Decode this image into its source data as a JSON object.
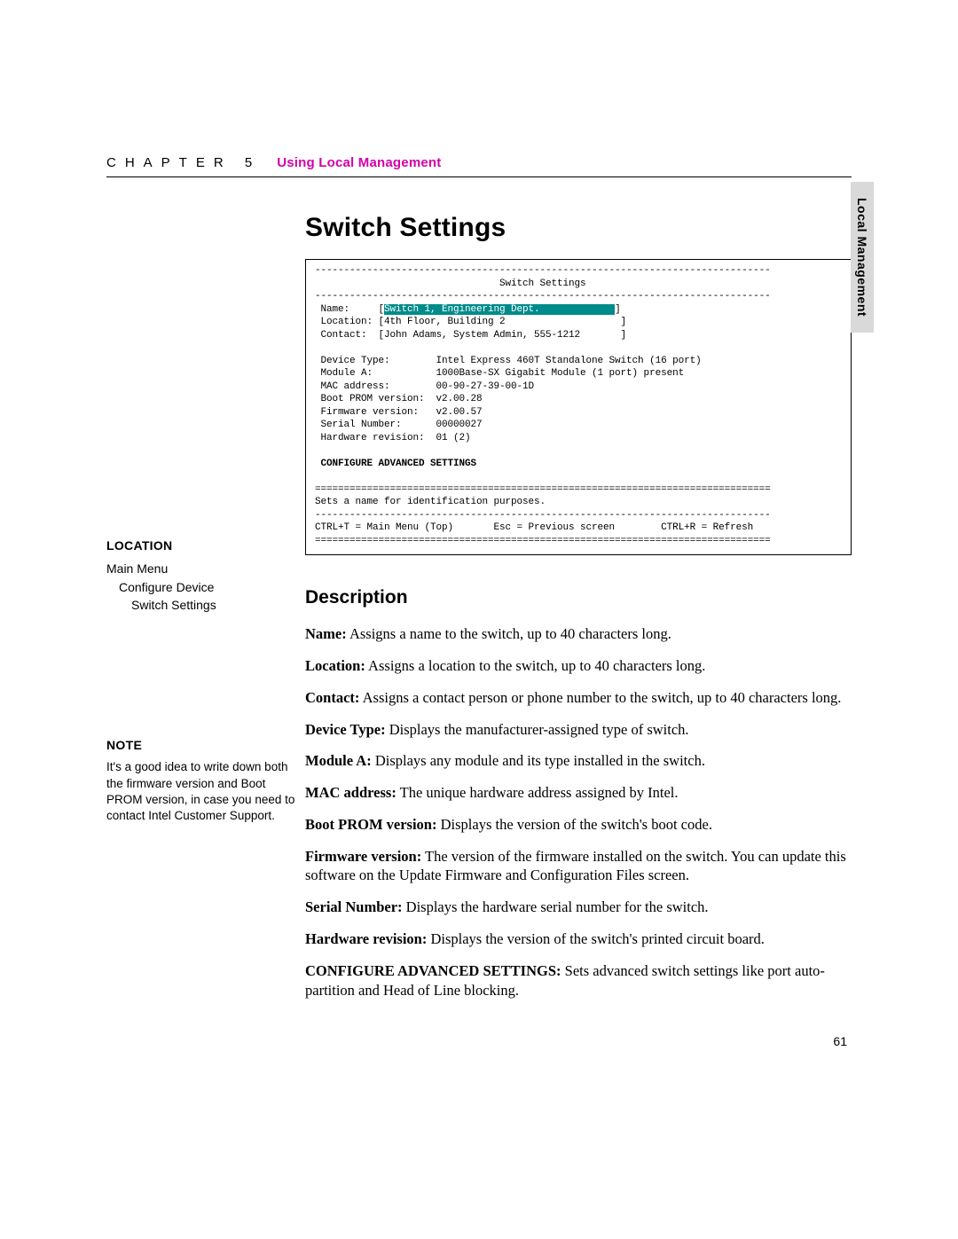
{
  "header": {
    "chapter_label": "CHAPTER 5",
    "chapter_title": "Using Local Management"
  },
  "side_tab": "Local Management",
  "page_number": "61",
  "page_title": "Switch Settings",
  "terminal": {
    "top_dash": "-------------------------------------------------------------------------------",
    "title": "                                Switch Settings",
    "dash2": "-------------------------------------------------------------------------------",
    "name_label": " Name:     [",
    "name_value": "Switch 1, Engineering Dept.             ",
    "name_close": "]",
    "location_line": " Location: [4th Floor, Building 2                    ]",
    "contact_line": " Contact:  [John Adams, System Admin, 555-1212       ]",
    "device_type": " Device Type:        Intel Express 460T Standalone Switch (16 port)",
    "module_a": " Module A:           1000Base-SX Gigabit Module (1 port) present",
    "mac": " MAC address:        00-90-27-39-00-1D",
    "boot": " Boot PROM version:  v2.00.28",
    "fw": " Firmware version:   v2.00.57",
    "serial": " Serial Number:      00000027",
    "hw": " Hardware revision:  01 (2)",
    "conf_adv": " CONFIGURE ADVANCED SETTINGS",
    "eq1": "===============================================================================",
    "help": "Sets a name for identification purposes.",
    "dash3": "-------------------------------------------------------------------------------",
    "footer": "CTRL+T = Main Menu (Top)       Esc = Previous screen        CTRL+R = Refresh",
    "eq2": "==============================================================================="
  },
  "sidebar": {
    "location_heading": "LOCATION",
    "loc1": "Main Menu",
    "loc2": "Configure Device",
    "loc3": "Switch Settings",
    "note_heading": "NOTE",
    "note_text": "It's a good idea to write down both the firmware version and Boot PROM version, in case you need to contact Intel Customer Support."
  },
  "description": {
    "heading": "Description",
    "items": [
      {
        "label": "Name:",
        "text": " Assigns a name to the switch, up to 40 characters long."
      },
      {
        "label": "Location:",
        "text": " Assigns a location to the switch, up to 40 characters long."
      },
      {
        "label": "Contact:",
        "text": " Assigns a contact person or phone number to the switch, up to 40 characters long."
      },
      {
        "label": "Device Type:",
        "text": " Displays the manufacturer-assigned type of switch."
      },
      {
        "label": "Module A:",
        "text": " Displays any module and its type installed in the switch."
      },
      {
        "label": "MAC address:",
        "text": " The unique hardware address assigned by Intel."
      },
      {
        "label": "Boot PROM version:",
        "text": " Displays the version of the switch's boot code."
      },
      {
        "label": "Firmware version:",
        "text": " The version of the firmware installed on the switch. You can update this software on the Update Firmware and Configuration Files screen."
      },
      {
        "label": "Serial Number:",
        "text": " Displays the hardware serial number for the switch."
      },
      {
        "label": "Hardware revision:",
        "text": " Displays the version of the switch's printed circuit board."
      },
      {
        "label": "CONFIGURE ADVANCED SETTINGS:",
        "text": " Sets advanced switch settings like port auto-partition and Head of Line blocking."
      }
    ]
  }
}
